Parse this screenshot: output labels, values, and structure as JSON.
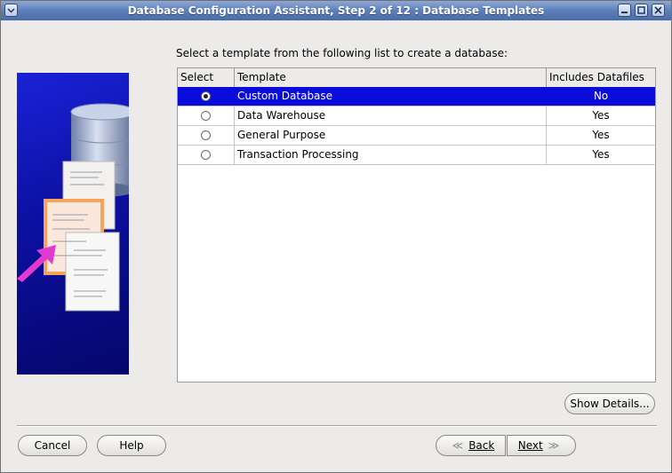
{
  "window": {
    "title": "Database Configuration Assistant, Step 2 of 12 : Database Templates"
  },
  "prompt": "Select a template from the following list to create a database:",
  "table": {
    "columns": [
      "Select",
      "Template",
      "Includes Datafiles"
    ],
    "rows": [
      {
        "template": "Custom Database",
        "datafiles": "No",
        "selected": true
      },
      {
        "template": "Data Warehouse",
        "datafiles": "Yes",
        "selected": false
      },
      {
        "template": "General Purpose",
        "datafiles": "Yes",
        "selected": false
      },
      {
        "template": "Transaction Processing",
        "datafiles": "Yes",
        "selected": false
      }
    ]
  },
  "buttons": {
    "show_details": "Show Details...",
    "cancel": "Cancel",
    "help": "Help",
    "back": "Back",
    "next": "Next"
  },
  "colors": {
    "title_bar": "#5c7fba",
    "selection": "#0a0cdc",
    "art_panel": "#0c10a0"
  }
}
